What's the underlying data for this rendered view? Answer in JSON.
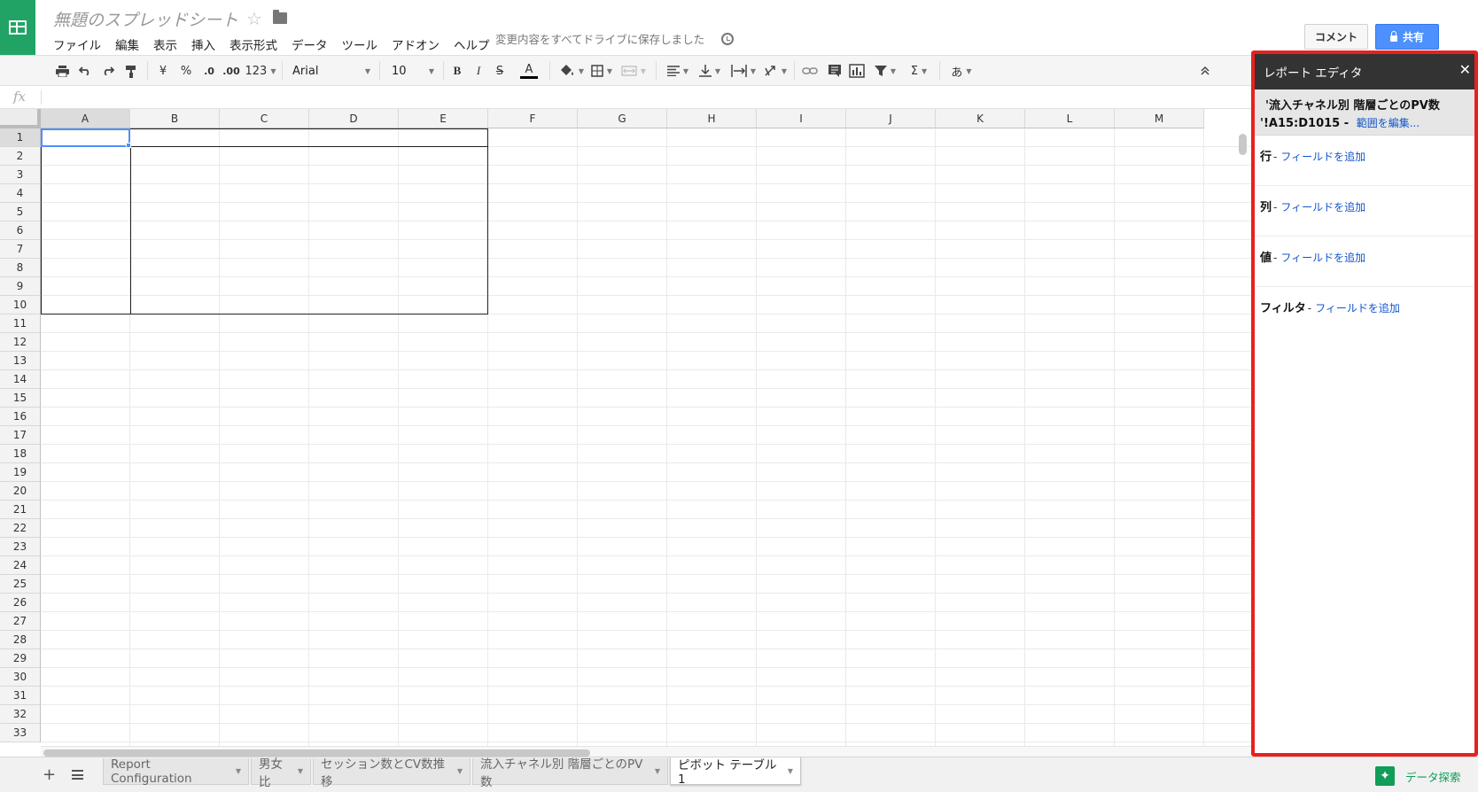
{
  "header": {
    "doc_title": "無題のスプレッドシート",
    "saved_status": "変更内容をすべてドライブに保存しました",
    "comment_button": "コメント",
    "share_button": "共有"
  },
  "menu": [
    "ファイル",
    "編集",
    "表示",
    "挿入",
    "表示形式",
    "データ",
    "ツール",
    "アドオン",
    "ヘルプ"
  ],
  "toolbar": {
    "currency": "¥",
    "percent": "%",
    "decrease_decimal": ".0",
    "increase_decimal": ".00",
    "more_formats": "123",
    "font": "Arial",
    "font_size": "10",
    "bold": "B",
    "italic": "I",
    "strike": "S",
    "text_color": "A",
    "input_tools": "あ",
    "sum": "Σ"
  },
  "formula_bar": {
    "fx": "fx",
    "value": ""
  },
  "columns": [
    "A",
    "B",
    "C",
    "D",
    "E",
    "F",
    "G",
    "H",
    "I",
    "J",
    "K",
    "L",
    "M"
  ],
  "rows": [
    "1",
    "2",
    "3",
    "4",
    "5",
    "6",
    "7",
    "8",
    "9",
    "10",
    "11",
    "12",
    "13",
    "14",
    "15",
    "16",
    "17",
    "18",
    "19",
    "20",
    "21",
    "22",
    "23",
    "24",
    "25",
    "26",
    "27",
    "28",
    "29",
    "30",
    "31",
    "32",
    "33"
  ],
  "selected_cell": "A1",
  "sheet_tabs": [
    {
      "label": "Report Configuration",
      "active": false
    },
    {
      "label": "男女比",
      "active": false
    },
    {
      "label": "セッション数とCV数推移",
      "active": false
    },
    {
      "label": "流入チャネル別 階層ごとのPV数",
      "active": false
    },
    {
      "label": "ピボット テーブル 1",
      "active": true
    }
  ],
  "explore": {
    "label": "データ探索"
  },
  "report_editor": {
    "title": "レポート エディタ",
    "range_sheet": "'流入チャネル別 階層ごとのPV数",
    "range_cells": "'!A15:D1015 -",
    "range_edit": "範囲を編集...",
    "sections": [
      {
        "label": "行",
        "dash": "-",
        "add": "フィールドを追加"
      },
      {
        "label": "列",
        "dash": "-",
        "add": "フィールドを追加"
      },
      {
        "label": "値",
        "dash": "-",
        "add": "フィールドを追加"
      },
      {
        "label": "フィルタ",
        "dash": "-",
        "add": "フィールドを追加"
      }
    ]
  },
  "colors": {
    "brand_green": "#21a366",
    "share_blue": "#4d90fe",
    "highlight_red": "#e8201f",
    "link_blue": "#1155cc",
    "explore_green": "#0f9d58"
  }
}
